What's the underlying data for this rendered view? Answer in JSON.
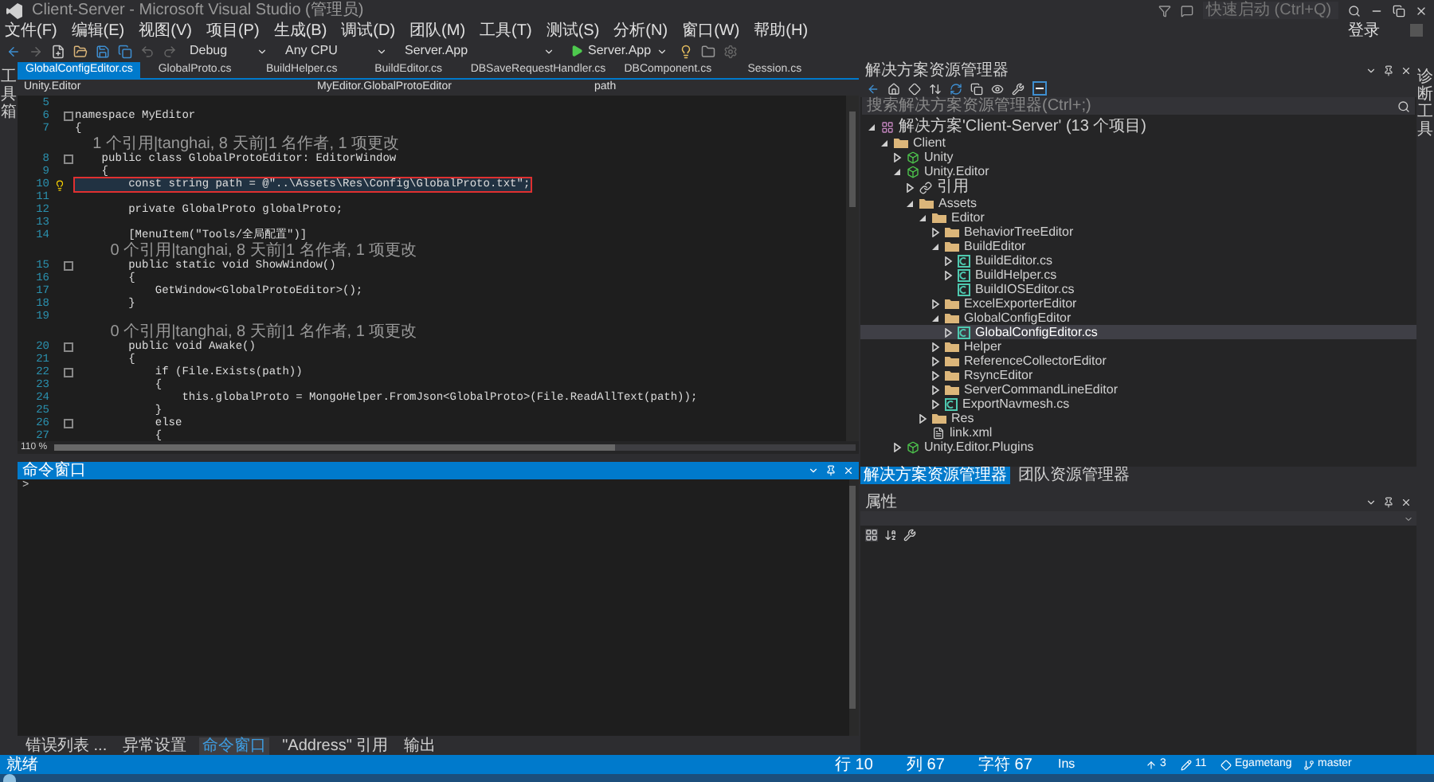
{
  "window": {
    "title": "Client-Server - Microsoft Visual Studio (管理员)",
    "quick_launch": {
      "placeholder": "快速启动 (Ctrl+Q)"
    },
    "sign_in": "登录"
  },
  "menu": [
    "文件(F)",
    "编辑(E)",
    "视图(V)",
    "项目(P)",
    "生成(B)",
    "调试(D)",
    "团队(M)",
    "工具(T)",
    "测试(S)",
    "分析(N)",
    "窗口(W)",
    "帮助(H)"
  ],
  "toolbar": {
    "configuration": "Debug",
    "platform": "Any CPU",
    "startup_project": "Server.App",
    "run": "Server.App"
  },
  "left_strip": "工具箱",
  "right_strip": "诊断工具",
  "document_tabs": [
    {
      "label": "GlobalConfigEditor.cs",
      "selected": true
    },
    {
      "label": "GlobalProto.cs",
      "selected": false
    },
    {
      "label": "BuildHelper.cs",
      "selected": false
    },
    {
      "label": "BuildEditor.cs",
      "selected": false
    },
    {
      "label": "DBSaveRequestHandler.cs",
      "selected": false
    },
    {
      "label": "DBComponent.cs",
      "selected": false
    },
    {
      "label": "Session.cs",
      "selected": false
    }
  ],
  "navigation": {
    "project": "Unity.Editor",
    "type": "MyEditor.GlobalProtoEditor",
    "member": "path"
  },
  "code_lines": [
    {
      "kind": "code",
      "number": "5",
      "fold": false,
      "lightbulb": false,
      "highlighted": false
    },
    {
      "kind": "code",
      "number": "6",
      "text": "namespace MyEditor",
      "fold": true,
      "lightbulb": false,
      "highlighted": false
    },
    {
      "kind": "code",
      "number": "7",
      "text": "{",
      "fold": false,
      "lightbulb": false,
      "highlighted": false
    },
    {
      "kind": "lens",
      "text": "    1 个引用|tanghai, 8 天前|1 名作者, 1 项更改"
    },
    {
      "kind": "code",
      "number": "8",
      "text": "    public class GlobalProtoEditor: EditorWindow",
      "fold": true,
      "lightbulb": false,
      "highlighted": false
    },
    {
      "kind": "code",
      "number": "9",
      "text": "    {",
      "fold": false,
      "lightbulb": false,
      "highlighted": false
    },
    {
      "kind": "code",
      "number": "10",
      "text": "        const string path = @\"..\\Assets\\Res\\Config\\GlobalProto.txt\";",
      "fold": false,
      "lightbulb": true,
      "highlighted": true
    },
    {
      "kind": "code",
      "number": "11",
      "fold": false,
      "lightbulb": false,
      "highlighted": false
    },
    {
      "kind": "code",
      "number": "12",
      "text": "        private GlobalProto globalProto;",
      "fold": false,
      "lightbulb": false,
      "highlighted": false
    },
    {
      "kind": "code",
      "number": "13",
      "fold": false,
      "lightbulb": false,
      "highlighted": false
    },
    {
      "kind": "code",
      "number": "14",
      "text": "        [MenuItem(\"Tools/全局配置\")]",
      "fold": false,
      "lightbulb": false,
      "highlighted": false
    },
    {
      "kind": "lens",
      "text": "        0 个引用|tanghai, 8 天前|1 名作者, 1 项更改"
    },
    {
      "kind": "code",
      "number": "15",
      "text": "        public static void ShowWindow()",
      "fold": true,
      "lightbulb": false,
      "highlighted": false
    },
    {
      "kind": "code",
      "number": "16",
      "text": "        {",
      "fold": false,
      "lightbulb": false,
      "highlighted": false
    },
    {
      "kind": "code",
      "number": "17",
      "text": "            GetWindow<GlobalProtoEditor>();",
      "fold": false,
      "lightbulb": false,
      "highlighted": false
    },
    {
      "kind": "code",
      "number": "18",
      "text": "        }",
      "fold": false,
      "lightbulb": false,
      "highlighted": false
    },
    {
      "kind": "code",
      "number": "19",
      "fold": false,
      "lightbulb": false,
      "highlighted": false
    },
    {
      "kind": "lens",
      "text": "        0 个引用|tanghai, 8 天前|1 名作者, 1 项更改"
    },
    {
      "kind": "code",
      "number": "20",
      "text": "        public void Awake()",
      "fold": true,
      "lightbulb": false,
      "highlighted": false
    },
    {
      "kind": "code",
      "number": "21",
      "text": "        {",
      "fold": false,
      "lightbulb": false,
      "highlighted": false
    },
    {
      "kind": "code",
      "number": "22",
      "text": "            if (File.Exists(path))",
      "fold": true,
      "lightbulb": false,
      "highlighted": false
    },
    {
      "kind": "code",
      "number": "23",
      "text": "            {",
      "fold": false,
      "lightbulb": false,
      "highlighted": false
    },
    {
      "kind": "code",
      "number": "24",
      "text": "                this.globalProto = MongoHelper.FromJson<GlobalProto>(File.ReadAllText(path));",
      "fold": false,
      "lightbulb": false,
      "highlighted": false
    },
    {
      "kind": "code",
      "number": "25",
      "text": "            }",
      "fold": false,
      "lightbulb": false,
      "highlighted": false
    },
    {
      "kind": "code",
      "number": "26",
      "text": "            else",
      "fold": true,
      "lightbulb": false,
      "highlighted": false
    },
    {
      "kind": "code",
      "number": "27",
      "text": "            {",
      "fold": false,
      "lightbulb": false,
      "highlighted": false
    }
  ],
  "zoom": "110 %",
  "command_window": {
    "title": "命令窗口",
    "prompt": ">"
  },
  "bottom_tabs": [
    {
      "label": "错误列表 ...",
      "selected": false
    },
    {
      "label": "异常设置",
      "selected": false
    },
    {
      "label": "命令窗口",
      "selected": true
    },
    {
      "label": "\"Address\" 引用",
      "selected": false
    },
    {
      "label": "输出",
      "selected": false
    }
  ],
  "solution_explorer": {
    "title": "解决方案资源管理器",
    "search": {
      "placeholder": "搜索解决方案资源管理器(Ctrl+;)"
    },
    "tree": [
      {
        "label": "解决方案'Client-Server' (13 个项目)",
        "kind": "solution",
        "expanded": true,
        "selected": false,
        "children": [
          {
            "label": "Client",
            "kind": "folder",
            "expanded": true,
            "selected": false,
            "children": [
              {
                "label": "Unity",
                "kind": "project",
                "expanded": false,
                "selected": false
              },
              {
                "label": "Unity.Editor",
                "kind": "project",
                "expanded": true,
                "selected": false,
                "children": [
                  {
                    "label": "引用",
                    "kind": "references",
                    "expanded": false,
                    "selected": false
                  },
                  {
                    "label": "Assets",
                    "kind": "folder",
                    "expanded": true,
                    "selected": false,
                    "children": [
                      {
                        "label": "Editor",
                        "kind": "folder",
                        "expanded": true,
                        "selected": false,
                        "children": [
                          {
                            "label": "BehaviorTreeEditor",
                            "kind": "folder",
                            "expanded": false,
                            "selected": false
                          },
                          {
                            "label": "BuildEditor",
                            "kind": "folder",
                            "expanded": true,
                            "selected": false,
                            "children": [
                              {
                                "label": "BuildEditor.cs",
                                "kind": "csharp",
                                "expanded": false,
                                "selected": false
                              },
                              {
                                "label": "BuildHelper.cs",
                                "kind": "csharp",
                                "expanded": false,
                                "selected": false
                              },
                              {
                                "label": "BuildIOSEditor.cs",
                                "kind": "csharp",
                                "selected": false
                              }
                            ]
                          },
                          {
                            "label": "ExcelExporterEditor",
                            "kind": "folder",
                            "expanded": false,
                            "selected": false
                          },
                          {
                            "label": "GlobalConfigEditor",
                            "kind": "folder",
                            "expanded": true,
                            "selected": false,
                            "children": [
                              {
                                "label": "GlobalConfigEditor.cs",
                                "kind": "csharp",
                                "expanded": false,
                                "selected": true
                              }
                            ]
                          },
                          {
                            "label": "Helper",
                            "kind": "folder",
                            "expanded": false,
                            "selected": false
                          },
                          {
                            "label": "ReferenceCollectorEditor",
                            "kind": "folder",
                            "expanded": false,
                            "selected": false
                          },
                          {
                            "label": "RsyncEditor",
                            "kind": "folder",
                            "expanded": false,
                            "selected": false
                          },
                          {
                            "label": "ServerCommandLineEditor",
                            "kind": "folder",
                            "expanded": false,
                            "selected": false
                          },
                          {
                            "label": "ExportNavmesh.cs",
                            "kind": "csharp",
                            "expanded": false,
                            "selected": false
                          }
                        ]
                      },
                      {
                        "label": "Res",
                        "kind": "folder",
                        "expanded": false,
                        "selected": false
                      },
                      {
                        "label": "link.xml",
                        "kind": "file",
                        "selected": false
                      }
                    ]
                  }
                ]
              },
              {
                "label": "Unity.Editor.Plugins",
                "kind": "project",
                "expanded": false,
                "selected": false
              }
            ]
          }
        ]
      }
    ]
  },
  "explorer_tabs": [
    {
      "label": "解决方案资源管理器",
      "selected": true
    },
    {
      "label": "团队资源管理器",
      "selected": false
    }
  ],
  "properties": {
    "title": "属性"
  },
  "status_bar": {
    "state": "就绪",
    "line": "行 10",
    "column": "列 67",
    "char": "字符 67",
    "mode": "Ins",
    "pushes": "3",
    "changes": "11",
    "repository": "Egametang",
    "branch": "master"
  }
}
